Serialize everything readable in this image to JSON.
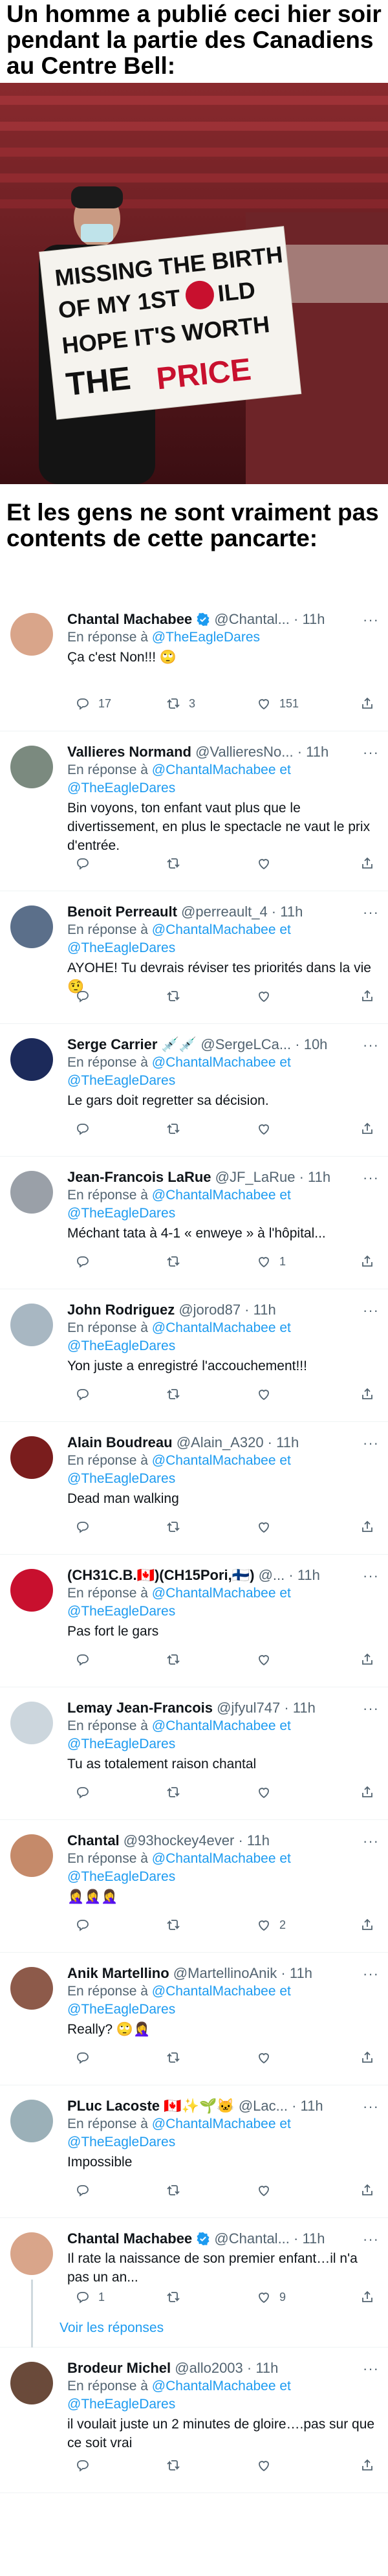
{
  "headline_top": "Un homme a publié ceci hier soir pendant la partie des Canadiens au Centre Bell:",
  "headline_mid": "Et les gens ne sont vraiment pas contents de cette pancarte:",
  "photo": {
    "sign_lines": [
      "MISSING THE BIRTH",
      "OF MY 1ST CH ILD",
      "HOPE IT'S WORTH",
      "THE PRICE"
    ]
  },
  "reply_prefix": "En réponse à",
  "view_replies": "Voir les réponses",
  "colors": {
    "link": "#1d9bf0",
    "muted": "#536471",
    "verified": "#1d9bf0"
  },
  "tweets": [
    {
      "name": "Chantal Machabee",
      "handle": "@Chantal...",
      "time": "· 11h",
      "verified": true,
      "reply": "@TheEagleDares",
      "text": "Ça c'est Non!!! 🙄",
      "replies": "17",
      "retweets": "3",
      "likes": "151"
    },
    {
      "name": "Vallieres Normand",
      "handle": "@VallieresNo...",
      "time": "· 11h",
      "reply": "@ChantalMachabee  et @TheEagleDares",
      "text": "Bin voyons, ton enfant vaut plus que le divertissement, en plus le spectacle ne vaut le prix d'entrée.",
      "replies": "",
      "retweets": "",
      "likes": ""
    },
    {
      "name": "Benoit Perreault",
      "handle": "@perreault_4",
      "time": "· 11h",
      "reply": "@ChantalMachabee  et @TheEagleDares",
      "text": "AYOHE! Tu devrais réviser tes priorités dans la vie 🤨",
      "replies": "",
      "retweets": "",
      "likes": ""
    },
    {
      "name": "Serge Carrier 💉💉",
      "handle": "@SergeLCa...",
      "time": "· 10h",
      "reply": "@ChantalMachabee  et @TheEagleDares",
      "text": "Le gars doit regretter sa décision.",
      "replies": "",
      "retweets": "",
      "likes": ""
    },
    {
      "name": "Jean-Francois LaRue",
      "handle": "@JF_LaRue",
      "time": "· 11h",
      "reply": "@ChantalMachabee  et @TheEagleDares",
      "text": "Méchant tata à 4-1 « enweye » à l'hôpital...",
      "replies": "",
      "retweets": "",
      "likes": "1"
    },
    {
      "name": "John Rodriguez",
      "handle": "@jorod87",
      "time": "· 11h",
      "reply": "@ChantalMachabee  et @TheEagleDares",
      "text": "Yon juste a enregistré l'accouchement!!!",
      "replies": "",
      "retweets": "",
      "likes": ""
    },
    {
      "name": "Alain Boudreau",
      "handle": "@Alain_A320",
      "time": "· 11h",
      "reply": "@ChantalMachabee  et @TheEagleDares",
      "text": "Dead man walking",
      "replies": "",
      "retweets": "",
      "likes": ""
    },
    {
      "name": "(CH31C.B.🇨🇦)(CH15Pori,🇫🇮)",
      "handle": "@...",
      "time": "· 11h",
      "reply": "@ChantalMachabee  et @TheEagleDares",
      "text": "Pas fort le gars",
      "replies": "",
      "retweets": "",
      "likes": ""
    },
    {
      "name": "Lemay Jean-Francois",
      "handle": "@jfyul747",
      "time": "· 11h",
      "reply": "@ChantalMachabee  et @TheEagleDares",
      "text": "Tu as totalement raison chantal",
      "replies": "",
      "retweets": "",
      "likes": ""
    },
    {
      "name": "Chantal",
      "handle": "@93hockey4ever",
      "time": "· 11h",
      "reply": "@ChantalMachabee  et @TheEagleDares",
      "text": "🤦‍♀️🤦‍♀️🤦‍♀️",
      "replies": "",
      "retweets": "",
      "likes": "2"
    },
    {
      "name": "Anik Martellino",
      "handle": "@MartellinoAnik",
      "time": "· 11h",
      "reply": "@ChantalMachabee  et @TheEagleDares",
      "text": "Really? 🙄🤦‍♀️",
      "replies": "",
      "retweets": "",
      "likes": ""
    },
    {
      "name": "PLuc Lacoste 🇨🇦✨🌱🐱",
      "handle": "@Lac...",
      "time": "· 11h",
      "reply": "@ChantalMachabee  et @TheEagleDares",
      "text": "Impossible",
      "replies": "",
      "retweets": "",
      "likes": ""
    },
    {
      "name": "Chantal Machabee",
      "handle": "@Chantal...",
      "time": "· 11h",
      "verified": true,
      "reply": "",
      "text": "Il rate la naissance de son premier enfant…il n'a pas un an...",
      "replies": "1",
      "retweets": "",
      "likes": "9"
    },
    {
      "name": "Brodeur Michel",
      "handle": "@allo2003",
      "time": "· 11h",
      "reply": "@ChantalMachabee  et @TheEagleDares",
      "text": "il voulait juste un 2 minutes de gloire….pas sur que ce soit vrai",
      "replies": "",
      "retweets": "",
      "likes": ""
    }
  ]
}
